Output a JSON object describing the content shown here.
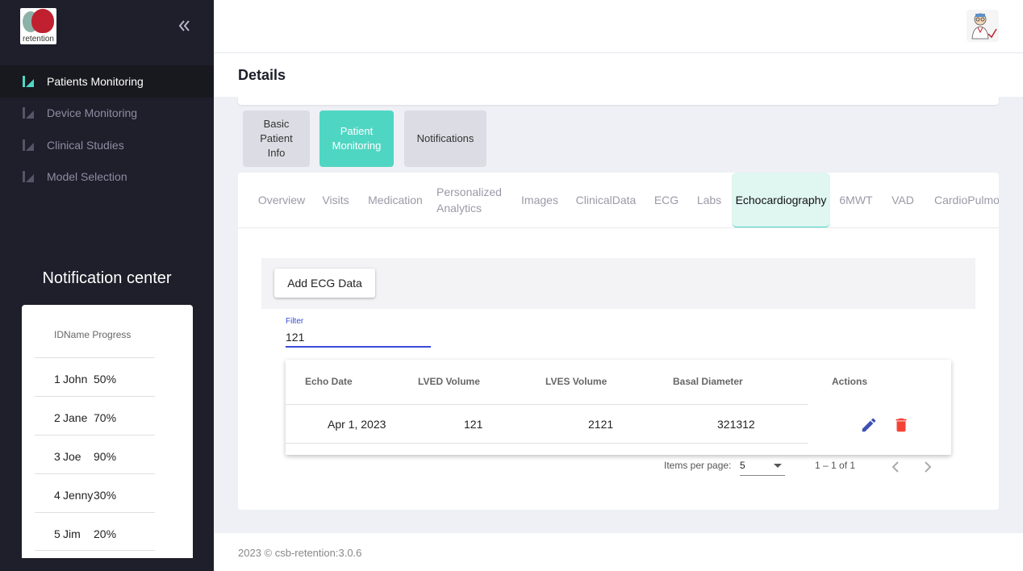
{
  "brand": {
    "logo_text": "retention"
  },
  "sidebar": {
    "items": [
      {
        "label": "Patients Monitoring",
        "active": true
      },
      {
        "label": "Device Monitoring",
        "active": false
      },
      {
        "label": "Clinical Studies",
        "active": false
      },
      {
        "label": "Model Selection",
        "active": false
      }
    ]
  },
  "notifications": {
    "title": "Notification center",
    "header": "IDName Progress",
    "rows": [
      {
        "id": "1",
        "name": "John",
        "progress": "50%"
      },
      {
        "id": "2",
        "name": "Jane",
        "progress": "70%"
      },
      {
        "id": "3",
        "name": "Joe",
        "progress": "90%"
      },
      {
        "id": "4",
        "name": "Jenny",
        "progress": "30%"
      },
      {
        "id": "5",
        "name": "Jim",
        "progress": "20%"
      }
    ]
  },
  "header": {
    "title": "Details"
  },
  "top_tabs": [
    {
      "label": "Basic Patient Info",
      "active": false
    },
    {
      "label": "Patient Monitoring",
      "active": true
    },
    {
      "label": "Notifications",
      "active": false
    }
  ],
  "sub_tabs": [
    {
      "label": "Overview"
    },
    {
      "label": "Visits"
    },
    {
      "label": "Medication"
    },
    {
      "label": "Personalized Analytics"
    },
    {
      "label": "Images"
    },
    {
      "label": "ClinicalData"
    },
    {
      "label": "ECG"
    },
    {
      "label": "Labs"
    },
    {
      "label": "Echocardiography",
      "active": true
    },
    {
      "label": "6MWT"
    },
    {
      "label": "VAD"
    },
    {
      "label": "CardioPulmon"
    }
  ],
  "toolbar": {
    "add_label": "Add ECG Data"
  },
  "filter": {
    "label": "Filter",
    "value": "121"
  },
  "table": {
    "columns": [
      "Echo Date",
      "LVED Volume",
      "LVES Volume",
      "Basal Diameter",
      "Actions"
    ],
    "rows": [
      {
        "echo_date": "Apr 1, 2023",
        "lved": "121",
        "lves": "2121",
        "basal": "321312"
      }
    ]
  },
  "pagination": {
    "items_label": "Items per page:",
    "per_page": "5",
    "range": "1 – 1 of 1"
  },
  "footer": {
    "text": "2023 ©  csb-retention:3.0.6"
  },
  "colors": {
    "accent": "#4fd6c3",
    "edit": "#3f51b5",
    "delete": "#f44336",
    "sidebar": "#1f1f2b"
  },
  "icons": [
    "collapse-chevrons-icon",
    "nav-icon",
    "doctor-avatar",
    "edit-pencil-icon",
    "delete-trash-icon",
    "chevron-left-icon",
    "chevron-right-icon",
    "dropdown-caret-icon"
  ]
}
